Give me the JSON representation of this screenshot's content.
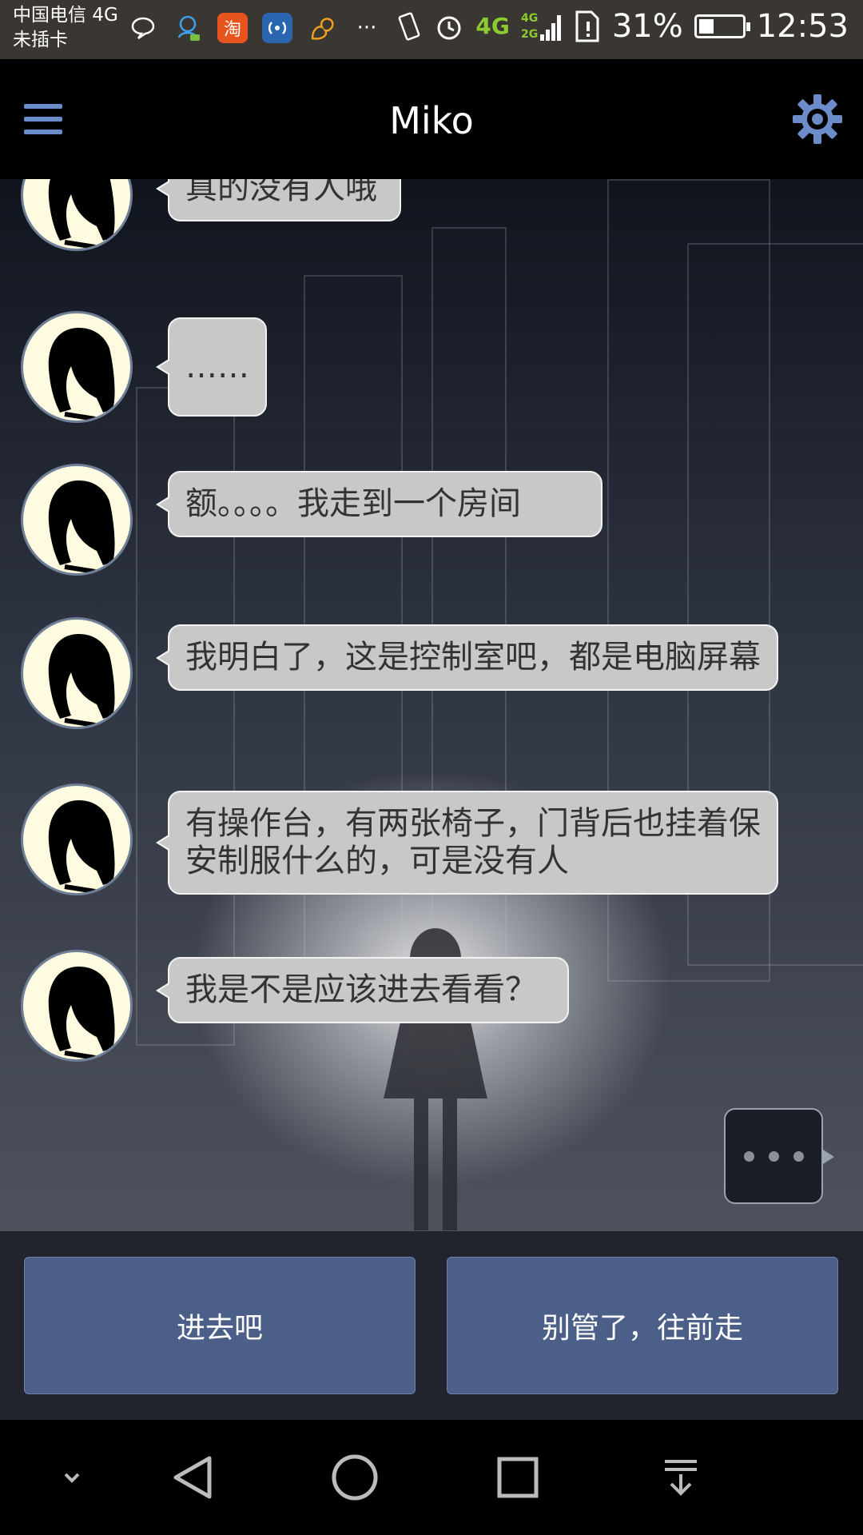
{
  "status_bar": {
    "carrier_line1": "中国电信 4G",
    "carrier_line2": "未插卡",
    "app_icons": [
      {
        "name": "chat-bubble-icon",
        "glyph": "💬",
        "bg": ""
      },
      {
        "name": "qq-icon",
        "glyph": "👤",
        "bg": ""
      },
      {
        "name": "taobao-icon",
        "glyph": "淘",
        "bg": "#e8541d"
      },
      {
        "name": "wifi-signal-icon",
        "glyph": "((·))",
        "bg": "#2a65b0"
      },
      {
        "name": "squirrel-icon",
        "glyph": "🐿",
        "bg": ""
      }
    ],
    "more": "···",
    "network_4g": "4G",
    "network_sub": "4G 2G",
    "battery_percent": 31,
    "battery_text": "31%",
    "time": "12:53"
  },
  "header": {
    "title": "Miko"
  },
  "messages": [
    {
      "text": "真的没有人哦"
    },
    {
      "text": "……"
    },
    {
      "text": "额。。。。我走到一个房间"
    },
    {
      "text": "我明白了，这是控制室吧，都是电脑屏幕"
    },
    {
      "text": "有操作台，有两张椅子，门背后也挂着保安制服什么的，可是没有人"
    },
    {
      "text": "我是不是应该进去看看？"
    }
  ],
  "choices": {
    "left": "进去吧",
    "right": "别管了，往前走"
  },
  "colors": {
    "accent": "#6b8cc8",
    "bubble": "#c8c8c8",
    "choice": "#4b5f88",
    "avatar_bg": "#fffbe1"
  }
}
